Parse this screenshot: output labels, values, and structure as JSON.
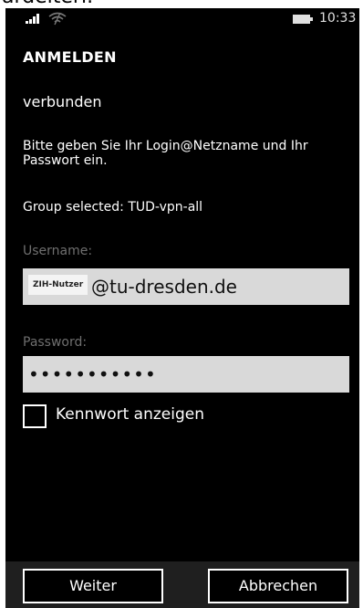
{
  "top_crop_text": "ardeiteri.",
  "status_bar": {
    "signal_icon": "signal-bars-icon",
    "wifi_icon": "wifi-icon",
    "battery_icon": "battery-icon",
    "time": "10:33"
  },
  "page": {
    "title": "ANMELDEN",
    "status": "verbunden",
    "instructions": "Bitte geben Sie Ihr Login@Netzname und Ihr Passwort ein.",
    "group": "Group selected: TUD-vpn-all"
  },
  "form": {
    "username_label": "Username:",
    "username_tag": "ZIH-Nutzer",
    "username_value": "@tu-dresden.de",
    "password_label": "Password:",
    "password_value": "•••••••••••",
    "show_password_label": "Kennwort anzeigen"
  },
  "buttons": {
    "next": "Weiter",
    "cancel": "Abbrechen"
  },
  "colors": {
    "background": "#000000",
    "field": "#d9d9d9",
    "muted_label": "#6f6f6f",
    "appbar": "#1f1f1f"
  }
}
